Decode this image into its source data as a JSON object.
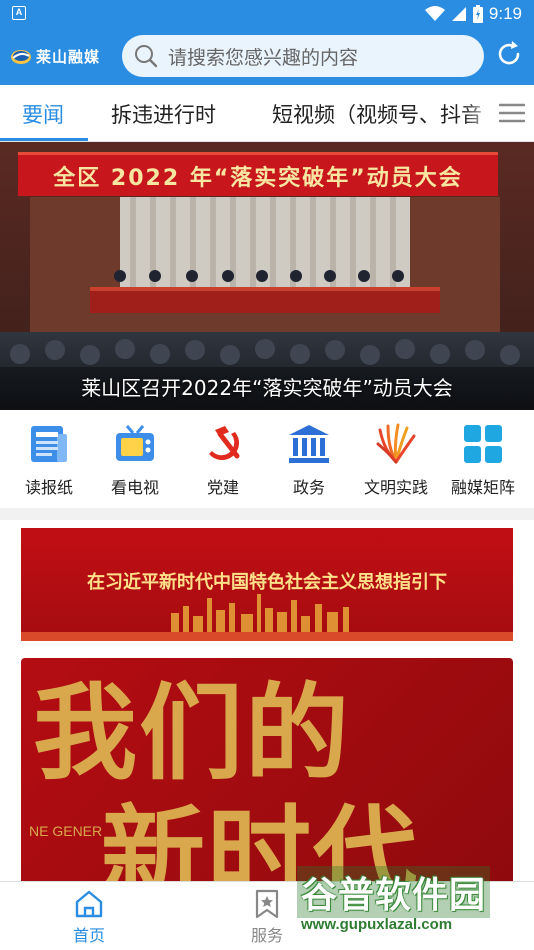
{
  "status_bar": {
    "time": "9:19",
    "left_badge": "A",
    "icons": [
      "wifi-icon",
      "signal-icon",
      "battery-icon"
    ]
  },
  "header": {
    "logo_text": "莱山融媒",
    "search_placeholder": "请搜索您感兴趣的内容",
    "refresh_icon": "refresh-icon"
  },
  "tabs": [
    {
      "label": "要闻",
      "active": true
    },
    {
      "label": "拆违进行时",
      "active": false
    },
    {
      "label": "短视频（视频号、抖音",
      "active": false
    }
  ],
  "hero": {
    "banner_text": "全区 2022 年“落实突破年”动员大会",
    "caption": "莱山区召开2022年“落实突破年”动员大会"
  },
  "quick_nav": [
    {
      "label": "读报纸",
      "icon": "newspaper-icon"
    },
    {
      "label": "看电视",
      "icon": "tv-icon"
    },
    {
      "label": "党建",
      "icon": "party-emblem-icon"
    },
    {
      "label": "政务",
      "icon": "government-building-icon"
    },
    {
      "label": "文明实践",
      "icon": "civilization-practice-icon"
    },
    {
      "label": "融媒矩阵",
      "icon": "grid-matrix-icon"
    }
  ],
  "promo": {
    "banner1_text": "在习近平新时代中国特色社会主义思想指引下",
    "banner2_line1": "我们的",
    "banner2_line2": "新时代",
    "banner2_side": "NE GENER"
  },
  "bottom_nav": [
    {
      "label": "首页",
      "icon": "home-icon",
      "active": true
    },
    {
      "label": "服务",
      "icon": "service-icon",
      "active": false
    }
  ],
  "watermark": {
    "main": "谷普软件园",
    "url": "www.gupuxlazal.com"
  },
  "colors": {
    "accent": "#2a8de2",
    "search_bg": "#eaf4fd",
    "banner_red": "#c10f14",
    "gold": "#d9a84c"
  }
}
